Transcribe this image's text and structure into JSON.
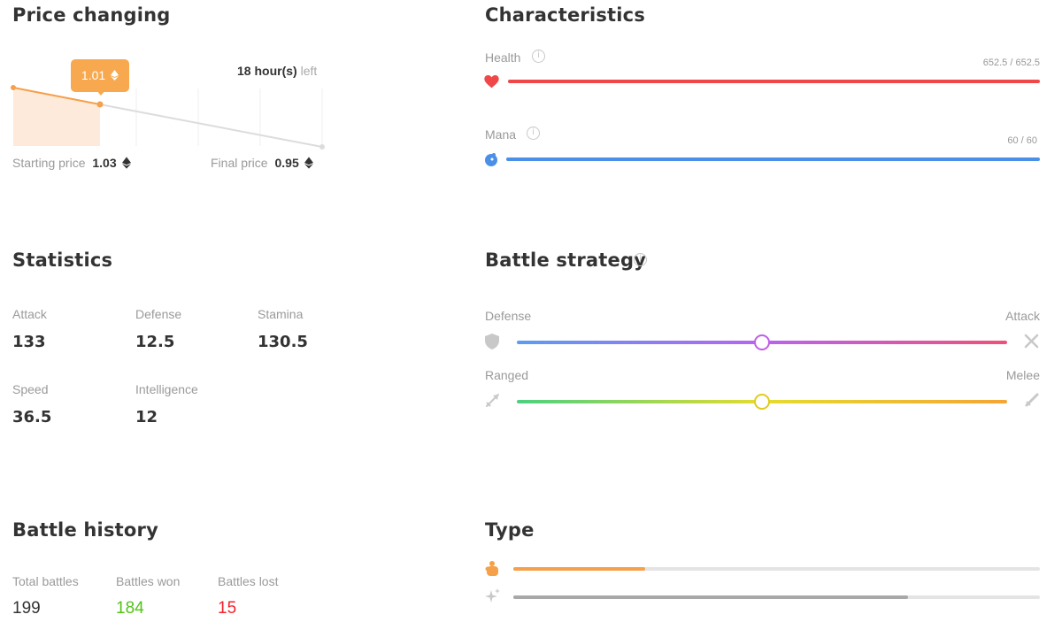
{
  "price": {
    "title": "Price changing",
    "tooltip_value": "1.01",
    "time_value": "18 hour(s)",
    "time_suffix": "left",
    "starting_label": "Starting price",
    "starting_value": "1.03",
    "final_label": "Final price",
    "final_value": "0.95",
    "elapsed_fraction": 0.28
  },
  "characteristics": {
    "title": "Characteristics",
    "health_label": "Health",
    "health_value": "652.5 / 652.5",
    "health_fill": 1.0,
    "mana_label": "Mana",
    "mana_value": "60 / 60",
    "mana_fill": 1.0,
    "health_color": "#f04848",
    "mana_color": "#4a90e8"
  },
  "statistics": {
    "title": "Statistics",
    "items": [
      {
        "label": "Attack",
        "value": "133"
      },
      {
        "label": "Defense",
        "value": "12.5"
      },
      {
        "label": "Stamina",
        "value": "130.5"
      },
      {
        "label": "Speed",
        "value": "36.5"
      },
      {
        "label": "Intelligence",
        "value": "12"
      }
    ]
  },
  "strategy": {
    "title": "Battle strategy",
    "defense_label": "Defense",
    "attack_label": "Attack",
    "ranged_label": "Ranged",
    "melee_label": "Melee",
    "attack_level": 0.5,
    "melee_level": 0.5
  },
  "history": {
    "title": "Battle history",
    "total_label": "Total battles",
    "total_value": "199",
    "won_label": "Battles won",
    "won_value": "184",
    "lost_label": "Battles lost",
    "lost_value": "15",
    "won_color": "#52c41a",
    "lost_color": "#f5222d"
  },
  "type": {
    "title": "Type",
    "bar1_fill": 0.25,
    "bar2_fill": 0.75,
    "bar1_color": "#f5a04a",
    "bar2_color": "#a8a8a8"
  }
}
